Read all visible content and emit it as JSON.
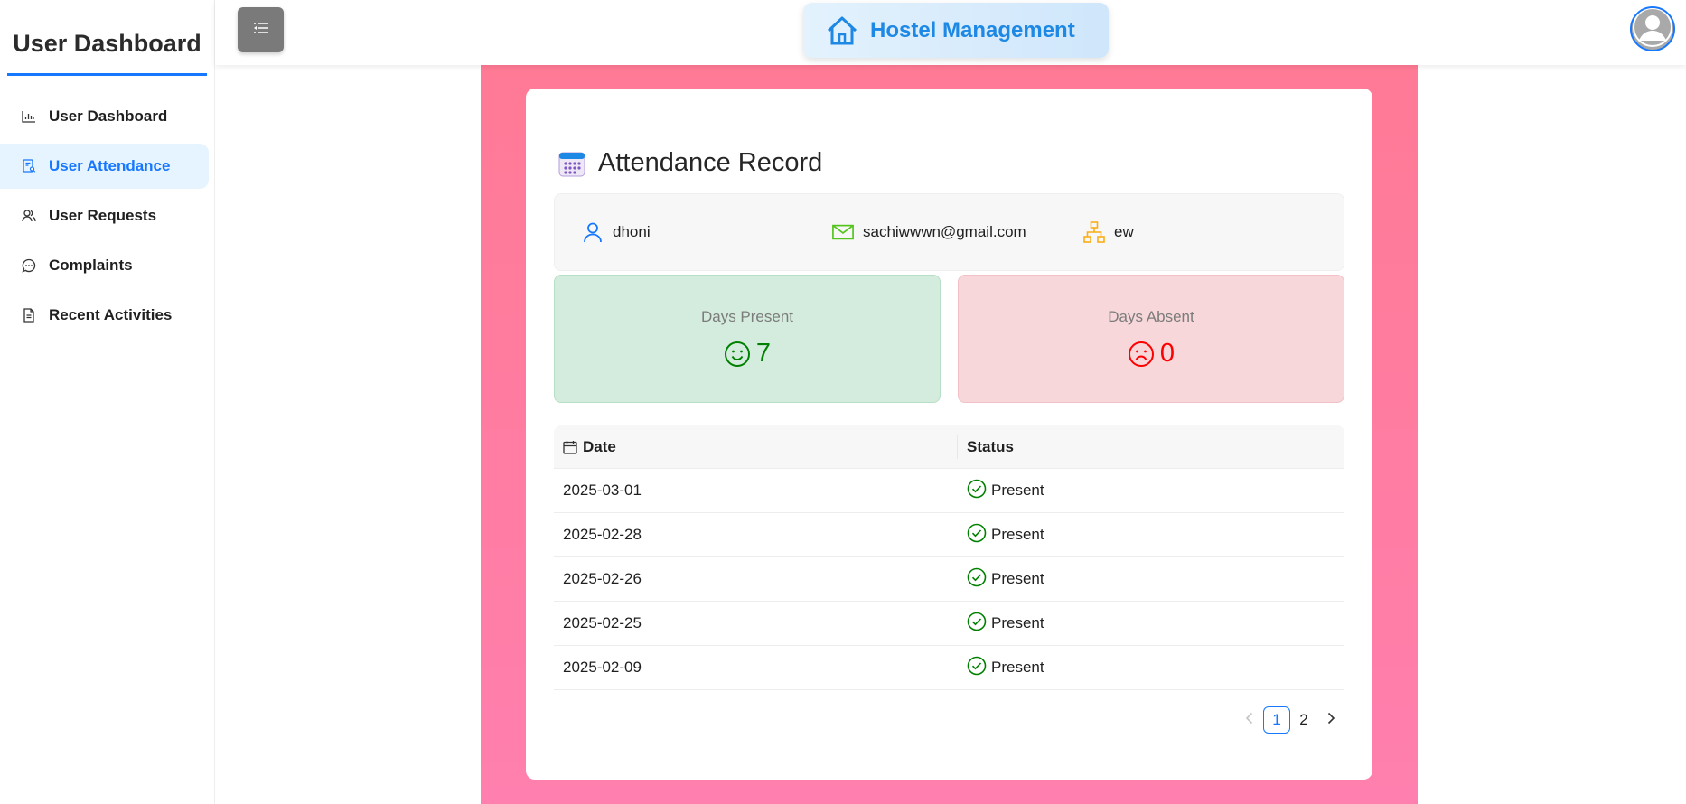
{
  "sidebar": {
    "title": "User Dashboard",
    "items": [
      {
        "label": "User Dashboard",
        "icon": "bar-chart-icon"
      },
      {
        "label": "User Attendance",
        "icon": "attendance-icon",
        "active": true
      },
      {
        "label": "User Requests",
        "icon": "users-icon"
      },
      {
        "label": "Complaints",
        "icon": "chat-bubble-icon"
      },
      {
        "label": "Recent Activities",
        "icon": "document-icon"
      }
    ]
  },
  "header": {
    "brand_title": "Hostel Management",
    "brand_icon": "home-icon",
    "toggle_icon": "menu-fold-icon",
    "avatar_icon": "user-avatar-icon"
  },
  "card": {
    "title": "Attendance Record",
    "info": {
      "name": "dhoni",
      "email": "sachiwwwn@gmail.com",
      "department": "ew"
    },
    "stats": {
      "present_label": "Days Present",
      "present_value": "7",
      "absent_label": "Days Absent",
      "absent_value": "0"
    },
    "table": {
      "columns": [
        "Date",
        "Status"
      ],
      "rows": [
        {
          "date": "2025-03-01",
          "status": "Present"
        },
        {
          "date": "2025-02-28",
          "status": "Present"
        },
        {
          "date": "2025-02-26",
          "status": "Present"
        },
        {
          "date": "2025-02-25",
          "status": "Present"
        },
        {
          "date": "2025-02-09",
          "status": "Present"
        }
      ]
    },
    "pagination": {
      "pages": [
        "1",
        "2"
      ],
      "current": "1"
    }
  },
  "colors": {
    "accent": "#1677ff",
    "brand_text": "#1e88e5",
    "present": "#008000",
    "absent": "#ff0000",
    "panel_pink": "#ff7a95"
  }
}
